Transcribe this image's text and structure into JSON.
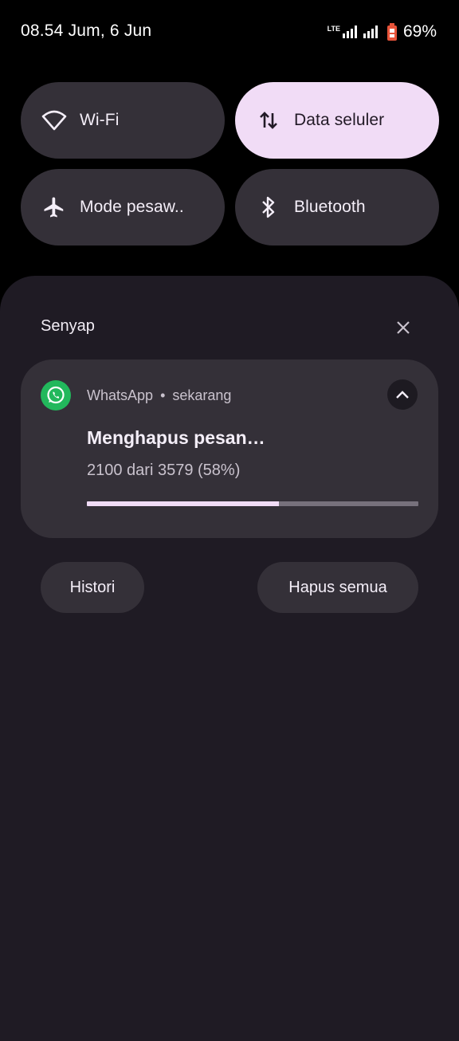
{
  "status_bar": {
    "time_date": "08.54 Jum, 6 Jun",
    "network_type": "LTE",
    "battery_percent": "69%",
    "battery_color": "#e8543a",
    "icons": [
      "lte-signal-icon",
      "signal-icon",
      "signal-icon",
      "battery-icon"
    ]
  },
  "quick_settings": {
    "tiles": [
      {
        "label": "Wi-Fi",
        "icon": "wifi-icon",
        "active": false
      },
      {
        "label": "Data seluler",
        "icon": "mobile-data-icon",
        "active": true
      },
      {
        "label": "Mode pesaw..",
        "icon": "airplane-icon",
        "active": false
      },
      {
        "label": "Bluetooth",
        "icon": "bluetooth-icon",
        "active": false
      }
    ]
  },
  "notifications": {
    "section_title": "Senyap",
    "close_icon": "close-icon",
    "items": [
      {
        "app_name": "WhatsApp",
        "separator": "•",
        "time": "sekarang",
        "app_icon": "whatsapp-icon",
        "app_color": "#22b85c",
        "title": "Menghapus pesan…",
        "text": "2100 dari 3579 (58%)",
        "progress_fraction": 0.58,
        "expand_icon": "chevron-up-icon"
      }
    ],
    "history_button": "Histori",
    "clear_all_button": "Hapus semua"
  },
  "colors": {
    "accent": "#f1dcf6",
    "tile_bg": "#343038",
    "shade_bg": "#1f1b24"
  }
}
